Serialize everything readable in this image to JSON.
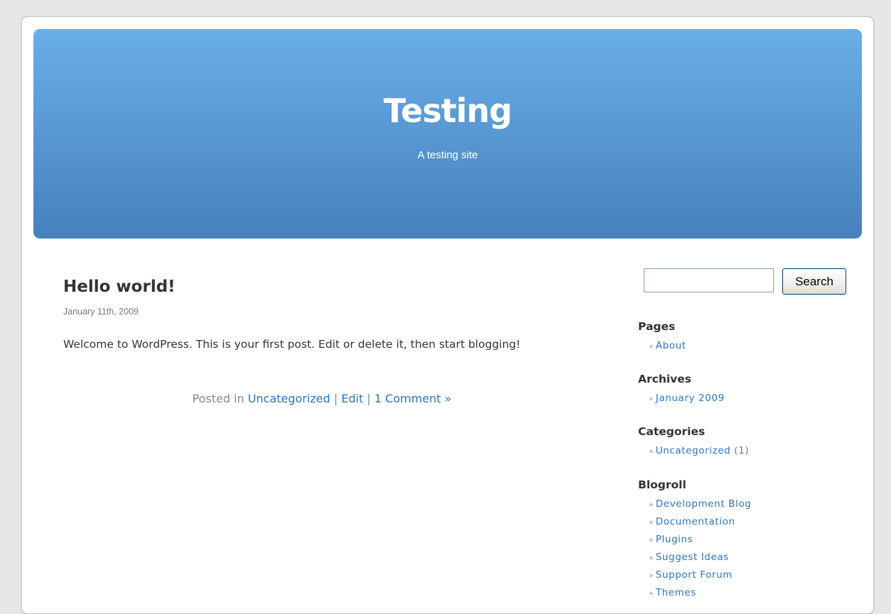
{
  "header": {
    "title": "Testing",
    "description": "A testing site"
  },
  "post": {
    "title": "Hello world!",
    "date": "January 11th, 2009",
    "body": "Welcome to WordPress. This is your first post. Edit or delete it, then start blogging!",
    "meta_prefix": "Posted in ",
    "category_link": "Uncategorized",
    "separator": " | ",
    "edit_link": "Edit",
    "comments_link": "1 Comment »"
  },
  "search": {
    "placeholder": "",
    "value": "",
    "button_label": "Search"
  },
  "sidebar": {
    "bullet": "»",
    "pages": {
      "heading": "Pages",
      "items": [
        "About"
      ]
    },
    "archives": {
      "heading": "Archives",
      "items": [
        "January 2009"
      ]
    },
    "categories": {
      "heading": "Categories",
      "items": [
        {
          "label": "Uncategorized",
          "count": "(1)"
        }
      ]
    },
    "blogroll": {
      "heading": "Blogroll",
      "items": [
        "Development Blog",
        "Documentation",
        "Plugins",
        "Suggest Ideas",
        "Support Forum",
        "Themes"
      ]
    }
  },
  "colors": {
    "link": "#2c74c4",
    "header_top": "#69aee7",
    "header_bottom": "#4582bd",
    "text": "#333333",
    "muted": "#777777"
  }
}
